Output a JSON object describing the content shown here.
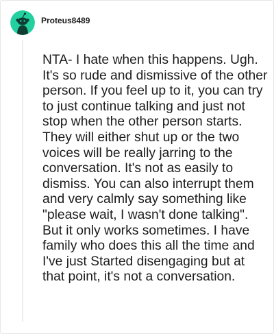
{
  "comment": {
    "author": "Proteus8489",
    "avatar_icon": "reddit-snoo-avatar-icon",
    "accent_color": "#25d0a0",
    "body": "NTA- I hate when this happens. Ugh. It's so rude and dismissive of the other person. If you feel up to it, you can try to just continue talking and just not stop when the other person starts. They will either shut up or the two voices will be really jarring to the conversation. It's not as easily to dismiss. You can also interrupt them and very calmly say something like \"please wait, I wasn't done talking\". But it only works sometimes. I have family who does this all the time and I've just Started disengaging but at that point, it's not a conversation."
  }
}
